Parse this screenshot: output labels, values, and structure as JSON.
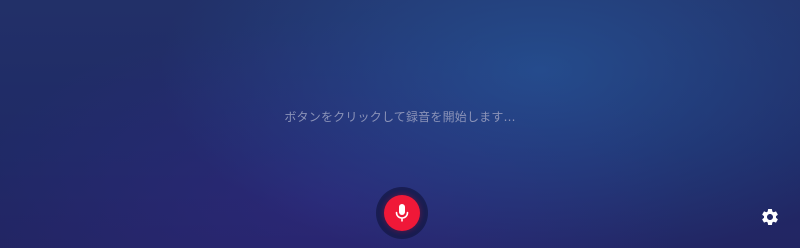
{
  "main": {
    "status_text": "ボタンをクリックして録音を開始します..."
  },
  "record_button": {
    "icon": "microphone-icon",
    "state": "idle",
    "color": "#f01838"
  },
  "settings_button": {
    "icon": "gear-icon",
    "color": "#ffffff"
  },
  "theme": {
    "background": "#1f2a66",
    "text_color": "#8b93b8"
  }
}
